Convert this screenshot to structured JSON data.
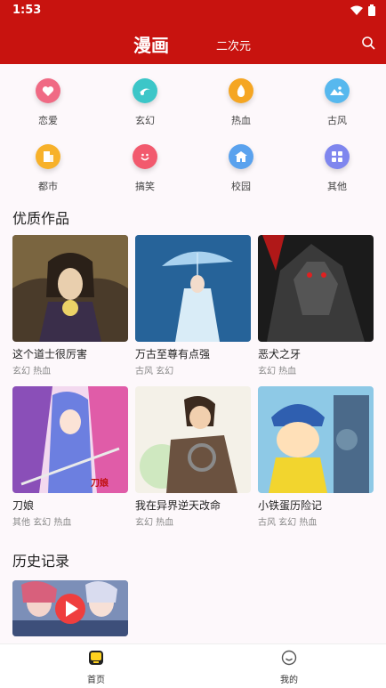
{
  "status": {
    "time": "1:53"
  },
  "header": {
    "active_tab": "漫画",
    "tab2": "二次元"
  },
  "categories": [
    {
      "label": "恋爱",
      "icon": "heart-icon",
      "color": "#f06a84"
    },
    {
      "label": "玄幻",
      "icon": "swirl-icon",
      "color": "#3cc6c8"
    },
    {
      "label": "热血",
      "icon": "flame-icon",
      "color": "#f5a623"
    },
    {
      "label": "古风",
      "icon": "landscape-icon",
      "color": "#57b8ee"
    },
    {
      "label": "都市",
      "icon": "building-icon",
      "color": "#f7b12a"
    },
    {
      "label": "搞笑",
      "icon": "smile-icon",
      "color": "#f25a6e"
    },
    {
      "label": "校园",
      "icon": "school-icon",
      "color": "#5aa2ee"
    },
    {
      "label": "其他",
      "icon": "grid-icon",
      "color": "#7f86ee"
    }
  ],
  "featured": {
    "title": "优质作品",
    "items": [
      {
        "title": "这个道士很厉害",
        "tags": "玄幻 热血"
      },
      {
        "title": "万古至尊有点强",
        "tags": "古风 玄幻"
      },
      {
        "title": "恶犬之牙",
        "tags": "玄幻 热血"
      },
      {
        "title": "刀娘",
        "tags": "其他 玄幻 热血"
      },
      {
        "title": "我在异界逆天改命",
        "tags": "玄幻 热血"
      },
      {
        "title": "小铁蛋历险记",
        "tags": "古风 玄幻 热血"
      }
    ]
  },
  "history": {
    "title": "历史记录"
  },
  "nav": {
    "home": "首页",
    "mine": "我的"
  }
}
